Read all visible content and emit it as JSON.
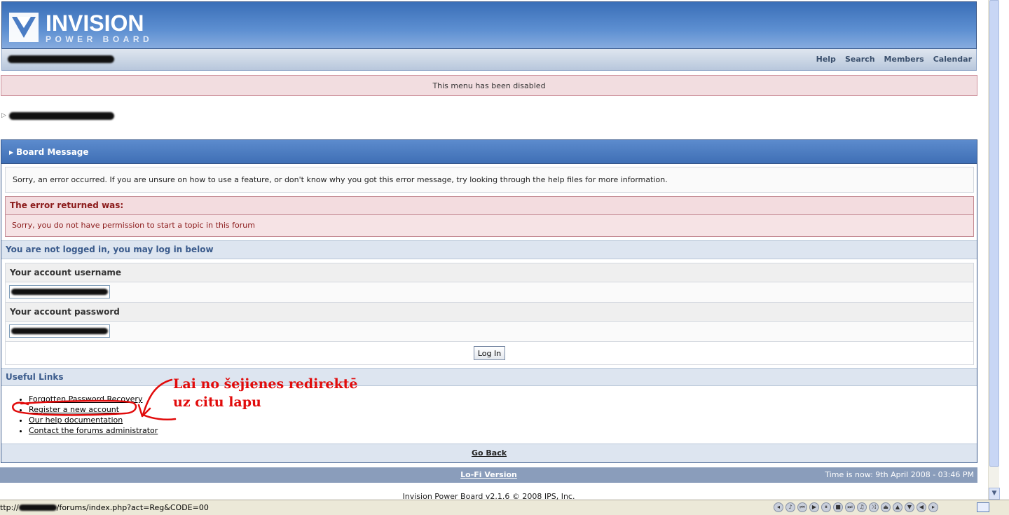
{
  "header": {
    "logo_main": "INVISION",
    "logo_sub": "POWER BOARD",
    "menu": [
      "Help",
      "Search",
      "Members",
      "Calendar"
    ]
  },
  "notice": {
    "menu_disabled": "This menu has been disabled"
  },
  "board_message": {
    "title": "Board Message",
    "intro": "Sorry, an error occurred. If you are unsure on how to use a feature, or don't know why you got this error message, try looking through the help files for more information.",
    "error_head": "The error returned was:",
    "error_msg": "Sorry, you do not have permission to start a topic in this forum"
  },
  "login": {
    "head": "You are not logged in, you may log in below",
    "username_label": "Your account username",
    "password_label": "Your account password",
    "button": "Log In"
  },
  "useful": {
    "head": "Useful Links",
    "links": [
      "Forgotten Password Recovery",
      "Register a new account",
      "Our help documentation",
      "Contact the forums administrator"
    ]
  },
  "go_back": "Go Back",
  "footer": {
    "lofi": "Lo-Fi Version",
    "time": "Time is now: 9th April 2008 - 03:46 PM",
    "copyright": "Invision Power Board v2.1.6 © 2008  IPS, Inc."
  },
  "annotation": {
    "line1": "Lai no šejienes redirektē",
    "line2": "uz citu lapu",
    "color": "#e10b0b"
  },
  "status_bar": {
    "url_prefix": "ttp://",
    "url_suffix": "/forums/index.php?act=Reg&CODE=00"
  }
}
